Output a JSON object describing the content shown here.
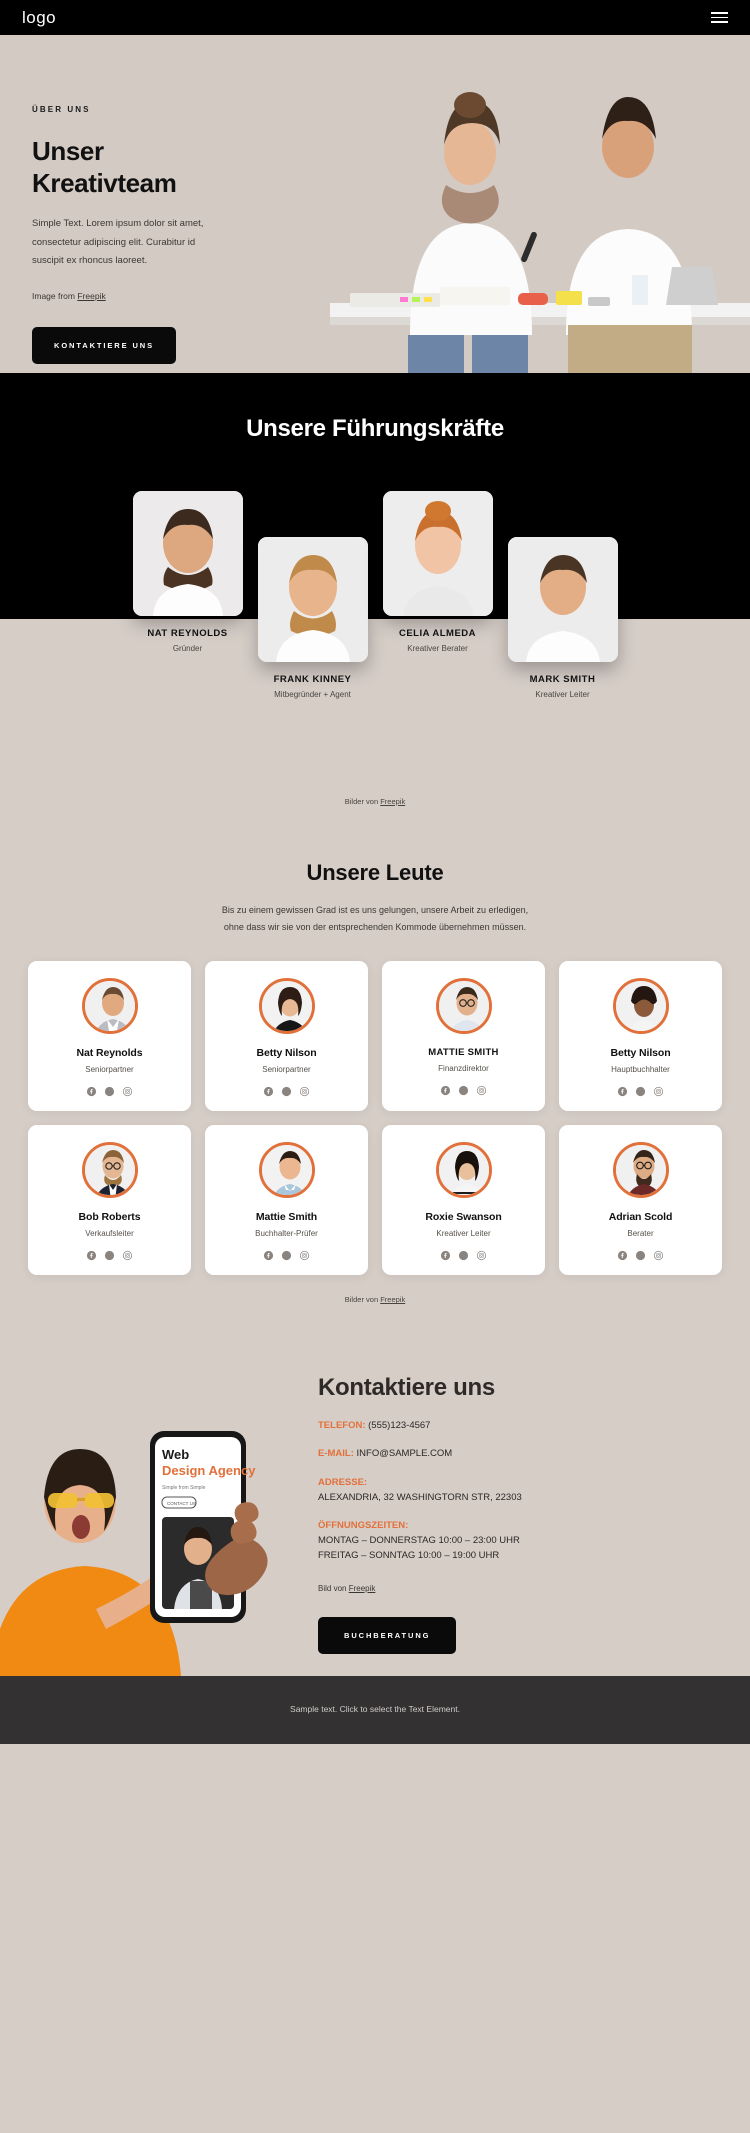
{
  "header": {
    "logo": "logo",
    "menu_icon": "hamburger-icon"
  },
  "hero": {
    "eyebrow": "ÜBER UNS",
    "title_line1": "Unser",
    "title_line2": "Kreativteam",
    "paragraph": "Simple Text. Lorem ipsum dolor sit amet, consectetur adipiscing elit. Curabitur id suscipit ex rhoncus laoreet.",
    "credit_prefix": "Image from ",
    "credit_link": "Freepik",
    "cta_label": "KONTAKTIERE UNS"
  },
  "leadership": {
    "title": "Unsere Führungskräfte",
    "credit_prefix": "Bilder von ",
    "credit_link": "Freepik",
    "members": [
      {
        "name": "NAT REYNOLDS",
        "role": "Gründer",
        "offset": "up"
      },
      {
        "name": "FRANK KINNEY",
        "role": "Mitbegründer + Agent",
        "offset": "down"
      },
      {
        "name": "CELIA ALMEDA",
        "role": "Kreativer Berater",
        "offset": "up"
      },
      {
        "name": "MARK SMITH",
        "role": "Kreativer Leiter",
        "offset": "down"
      }
    ]
  },
  "people": {
    "title": "Unsere Leute",
    "subtitle_line1": "Bis zu einem gewissen Grad ist es uns gelungen, unsere Arbeit zu erledigen,",
    "subtitle_line2": "ohne dass wir sie von der entsprechenden Kommode übernehmen müssen.",
    "credit_prefix": "Bilder von ",
    "credit_link": "Freepik",
    "social_icons": [
      "facebook-icon",
      "twitter-icon",
      "instagram-icon"
    ],
    "members": [
      {
        "name": "Nat Reynolds",
        "role": "Seniorpartner",
        "caps": false
      },
      {
        "name": "Betty Nilson",
        "role": "Seniorpartner",
        "caps": false
      },
      {
        "name": "MATTIE SMITH",
        "role": "Finanzdirektor",
        "caps": true
      },
      {
        "name": "Betty Nilson",
        "role": "Hauptbuchhalter",
        "caps": false
      },
      {
        "name": "Bob Roberts",
        "role": "Verkaufsleiter",
        "caps": false
      },
      {
        "name": "Mattie Smith",
        "role": "Buchhalter-Prüfer",
        "caps": false
      },
      {
        "name": "Roxie Swanson",
        "role": "Kreativer Leiter",
        "caps": false
      },
      {
        "name": "Adrian Scold",
        "role": "Berater",
        "caps": false
      }
    ]
  },
  "contact": {
    "heading": "Kontaktiere uns",
    "phone_label": "TELEFON:",
    "phone_value": "(555)123-4567",
    "email_label": "E-MAIL:",
    "email_value": "INFO@SAMPLE.COM",
    "address_label": "ADRESSE:",
    "address_value": "ALEXANDRIA, 32 WASHINGTORN STR, 22303",
    "hours_label": "ÖFFNUNGSZEITEN:",
    "hours_line1": "MONTAG – DONNERSTAG 10:00 – 23:00 UHR",
    "hours_line2": "FREITAG – SONNTAG 10:00 – 19:00 UHR",
    "credit_prefix": "Bild von ",
    "credit_link": "Freepik",
    "cta_label": "BUCHBERATUNG"
  },
  "footer": {
    "text": "Sample text. Click to select the Text Element."
  },
  "colors": {
    "accent": "#e2703a",
    "dark": "#000000",
    "beige": "#d6cdc7",
    "footer_bg": "#333132"
  }
}
